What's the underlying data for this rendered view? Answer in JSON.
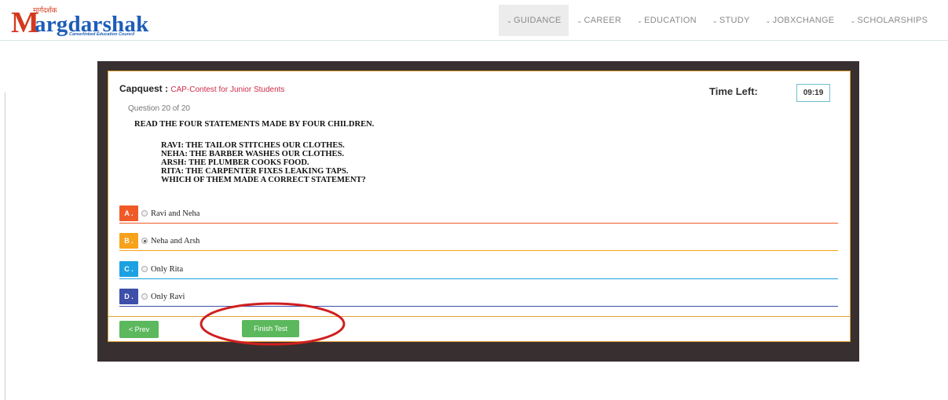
{
  "brand": {
    "hindi": "मार्गदर्शक",
    "initial": "M",
    "rest": "argdarshak",
    "tagline": "Careerlinked Education Council",
    "colors": {
      "primary": "#1d5db8",
      "accent": "#d4381d"
    }
  },
  "nav": {
    "items": [
      {
        "label": "GUIDANCE",
        "active": true
      },
      {
        "label": "CAREER"
      },
      {
        "label": "EDUCATION"
      },
      {
        "label": "STUDY"
      },
      {
        "label": "JOBXCHANGE"
      },
      {
        "label": "SCHOLARSHIPS"
      }
    ]
  },
  "quiz": {
    "title": "Capquest :",
    "contest": "CAP-Contest for Junior Students",
    "time_label": "Time Left:",
    "time_value": "09:19",
    "question_number": "Question 20 of 20",
    "question_text": "READ THE FOUR STATEMENTS MADE BY FOUR CHILDREN.",
    "question_lines": [
      "RAVI: THE TAILOR STITCHES OUR CLOTHES.",
      "NEHA: THE BARBER WASHES OUR CLOTHES.",
      "ARSH: THE PLUMBER COOKS FOOD.",
      "RITA: THE CARPENTER FIXES LEAKING TAPS.",
      "WHICH OF THEM MADE A CORRECT STATEMENT?"
    ],
    "options": [
      {
        "letter": "A .",
        "label": "Ravi and Neha",
        "color": "#f05a28",
        "selected": false
      },
      {
        "letter": "B .",
        "label": "Neha and Arsh",
        "color": "#f7a21b",
        "selected": true
      },
      {
        "letter": "C .",
        "label": "Only Rita",
        "color": "#1ba1e2",
        "selected": false
      },
      {
        "letter": "D .",
        "label": "Only Ravi",
        "color": "#3d4fa8",
        "selected": false
      }
    ],
    "prev_label": "< Prev",
    "finish_label": "Finish Test"
  }
}
